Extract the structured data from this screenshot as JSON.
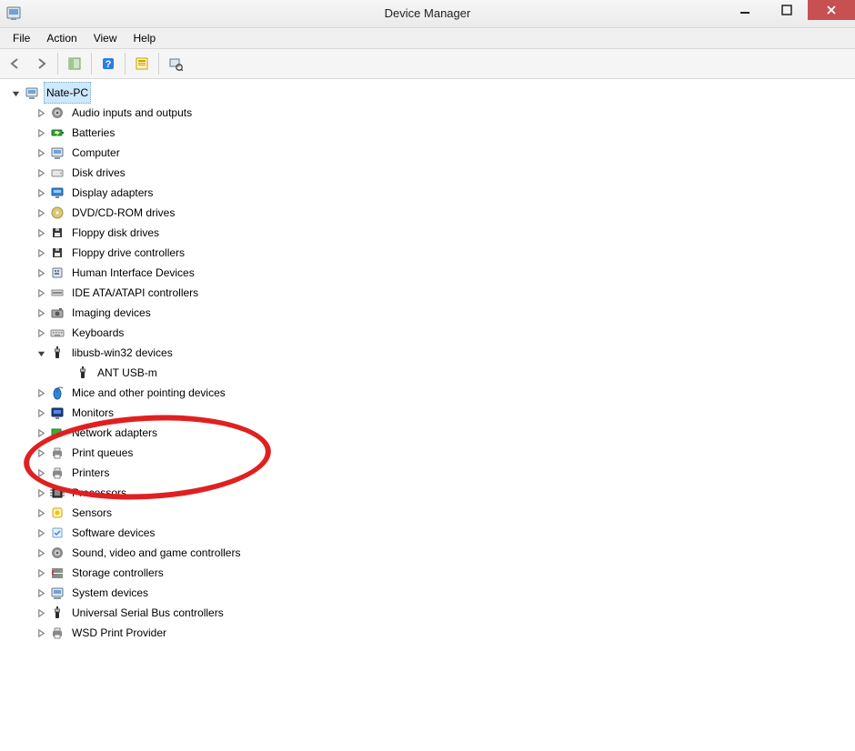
{
  "window": {
    "title": "Device Manager"
  },
  "menus": {
    "file": "File",
    "action": "Action",
    "view": "View",
    "help": "Help"
  },
  "root": {
    "label": "Nate-PC"
  },
  "categories": [
    {
      "key": "audio",
      "label": "Audio inputs and outputs",
      "icon": "speaker"
    },
    {
      "key": "batt",
      "label": "Batteries",
      "icon": "battery"
    },
    {
      "key": "computer",
      "label": "Computer",
      "icon": "pc"
    },
    {
      "key": "disk",
      "label": "Disk drives",
      "icon": "disk"
    },
    {
      "key": "display",
      "label": "Display adapters",
      "icon": "display"
    },
    {
      "key": "dvd",
      "label": "DVD/CD-ROM drives",
      "icon": "dvd"
    },
    {
      "key": "floppy",
      "label": "Floppy disk drives",
      "icon": "floppy"
    },
    {
      "key": "floppyc",
      "label": "Floppy drive controllers",
      "icon": "floppy"
    },
    {
      "key": "hid",
      "label": "Human Interface Devices",
      "icon": "hid"
    },
    {
      "key": "ide",
      "label": "IDE ATA/ATAPI controllers",
      "icon": "ide"
    },
    {
      "key": "imaging",
      "label": "Imaging devices",
      "icon": "camera"
    },
    {
      "key": "keyboard",
      "label": "Keyboards",
      "icon": "keyboard"
    },
    {
      "key": "libusb",
      "label": "libusb-win32 devices",
      "icon": "usb",
      "expanded": true,
      "children": [
        {
          "key": "antusbm",
          "label": "ANT USB-m",
          "icon": "usb"
        }
      ]
    },
    {
      "key": "mice",
      "label": "Mice and other pointing devices",
      "icon": "mouse"
    },
    {
      "key": "monitor",
      "label": "Monitors",
      "icon": "monitor"
    },
    {
      "key": "net",
      "label": "Network adapters",
      "icon": "nic"
    },
    {
      "key": "printq",
      "label": "Print queues",
      "icon": "printer"
    },
    {
      "key": "printer",
      "label": "Printers",
      "icon": "printer"
    },
    {
      "key": "proc",
      "label": "Processors",
      "icon": "cpu"
    },
    {
      "key": "sensor",
      "label": "Sensors",
      "icon": "sensor"
    },
    {
      "key": "sw",
      "label": "Software devices",
      "icon": "sw"
    },
    {
      "key": "sound",
      "label": "Sound, video and game controllers",
      "icon": "speaker"
    },
    {
      "key": "storctl",
      "label": "Storage controllers",
      "icon": "storage"
    },
    {
      "key": "sys",
      "label": "System devices",
      "icon": "system"
    },
    {
      "key": "usbctl",
      "label": "Universal Serial Bus controllers",
      "icon": "usb"
    },
    {
      "key": "wsd",
      "label": "WSD Print Provider",
      "icon": "printer"
    }
  ]
}
